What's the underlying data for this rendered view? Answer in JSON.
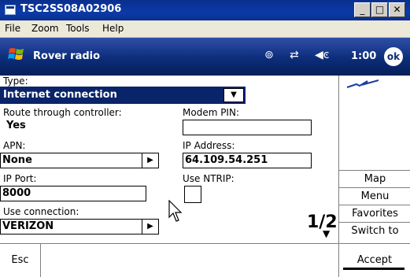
{
  "window": {
    "title": "TSC2SS08A02906",
    "minimize": "_",
    "maximize": "□",
    "close": "✕"
  },
  "menu": {
    "items": [
      "File",
      "Zoom",
      "Tools",
      "Help"
    ]
  },
  "navbar": {
    "title": "Rover radio",
    "time": "1:00",
    "ok_label": "ok",
    "icons": [
      "connectivity-icon",
      "network-icon",
      "volume-icon"
    ]
  },
  "form": {
    "type_label": "Type:",
    "type_value": "Internet connection",
    "route_label": "Route through controller:",
    "route_value": "Yes",
    "modem_pin_label": "Modem PIN:",
    "modem_pin_value": "",
    "apn_label": "APN:",
    "apn_value": "None",
    "ip_address_label": "IP Address:",
    "ip_address_value": "64.109.54.251",
    "ip_port_label": "IP Port:",
    "ip_port_value": "8000",
    "use_ntrip_label": "Use NTRIP:",
    "use_ntrip_checked": false,
    "use_connection_label": "Use connection:",
    "use_connection_value": "VERIZON",
    "page_indicator": "1/2"
  },
  "right_panel": {
    "buttons": [
      "Map",
      "Menu",
      "Favorites",
      "Switch to"
    ]
  },
  "bottom": {
    "esc_label": "Esc",
    "accept_label": "Accept"
  },
  "colors": {
    "title_bar": "#0a2f8e",
    "nav_bar": "#0c2d7a",
    "selection": "#0a246a"
  }
}
